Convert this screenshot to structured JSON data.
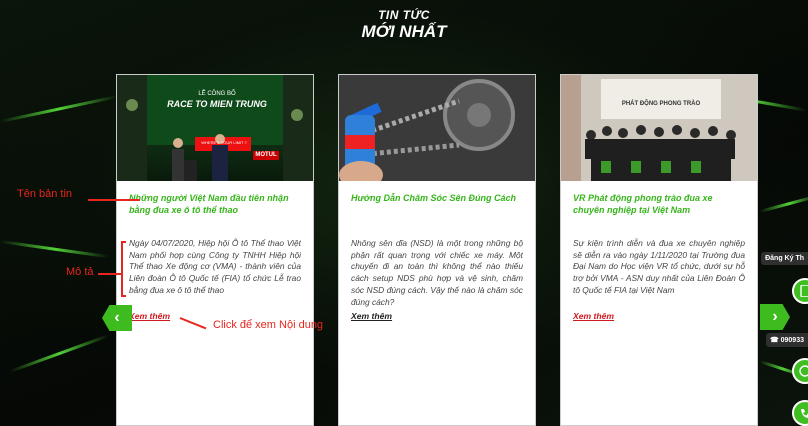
{
  "section": {
    "title_line1": "TIN TỨC",
    "title_line2": "MỚI NHẤT"
  },
  "cards": [
    {
      "headline": "Những người Việt Nam đầu tiên nhận bằng đua xe ô tô thể thao",
      "description": "Ngày 04/07/2020, Hiệp hội Ô tô Thể thao Việt Nam phối hợp cùng Công ty TNHH Hiệp hội Thể thao Xe động cơ (VMA) - thành viên của Liên đoàn Ô tô Quốc tế (FIA) tổ chức Lễ trao bằng đua xe ô tô thể thao",
      "read_more": "Xem thêm",
      "image_text": {
        "line1": "LỄ CÔNG BỐ",
        "line2": "RACE TO MIEN TRUNG",
        "banner": "WHERE'S YOUR LIMIT ?",
        "brand": "MOTUL"
      }
    },
    {
      "headline": "Hướng Dẫn Chăm Sóc Sên Đúng Cách",
      "description": "Nhông sên dĩa (NSD) là một trong những bộ phận rất quan trọng với chiếc xe máy. Một chuyến đi an toàn thì không thể nào thiếu cách setup NDS phù hợp và vệ sinh, chăm sóc NSD đúng cách. Vậy thế nào là chăm sóc đúng cách?",
      "read_more": "Xem thêm"
    },
    {
      "headline": "VR Phát động phong trào đua xe chuyên nghiệp tại Việt Nam",
      "description": "Sự kiện trình diễn và đua xe chuyên nghiệp sẽ diễn ra vào ngày 1/11/2020 tại Trường đua Đại Nam do Học viện VR tổ chức, dưới sự hỗ trợ bởi VMA - ASN duy nhất của Liên Đoàn Ô tô Quốc tế FIA tại Việt Nam",
      "read_more": "Xem thêm",
      "image_text": {
        "line1": "PHÁT ĐỘNG PHONG TRÀO"
      }
    }
  ],
  "annotations": {
    "headline_label": "Tên bản tin",
    "desc_label": "Mô tả",
    "click_label": "Click để xem Nội dung"
  },
  "side": {
    "register_label": "Đăng Ký Th",
    "phone_label": "☎ 090933"
  },
  "nav": {
    "prev": "‹",
    "next": "›"
  },
  "colors": {
    "accent": "#36b51a",
    "link": "#d0191d",
    "annotation": "#e6261e"
  }
}
